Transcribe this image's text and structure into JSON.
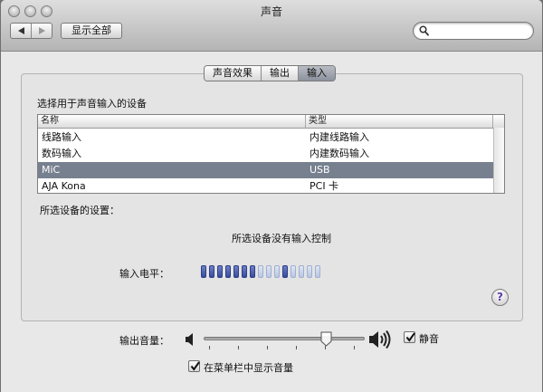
{
  "window": {
    "title": "声音"
  },
  "toolbar": {
    "show_all_label": "显示全部",
    "search_placeholder": ""
  },
  "tabs": [
    {
      "label": "声音效果",
      "active": false
    },
    {
      "label": "输出",
      "active": false
    },
    {
      "label": "输入",
      "active": true
    }
  ],
  "input_pane": {
    "title": "选择用于声音输入的设备",
    "columns": [
      "名称",
      "类型"
    ],
    "devices": [
      {
        "name": "线路输入",
        "type": "内建线路输入",
        "selected": false
      },
      {
        "name": "数码输入",
        "type": "内建数码输入",
        "selected": false
      },
      {
        "name": "MiC",
        "type": "USB",
        "selected": true
      },
      {
        "name": "AJA Kona",
        "type": "PCI 卡",
        "selected": false
      }
    ],
    "settings_label": "所选设备的设置：",
    "no_controls_text": "所选设备没有输入控制",
    "input_level_label": "输入电平：",
    "input_level": {
      "segments": 15,
      "lit": [
        0,
        1,
        2,
        3,
        4,
        5,
        6,
        10
      ]
    }
  },
  "help": {
    "glyph": "?"
  },
  "output": {
    "volume_label": "输出音量：",
    "volume_fraction": 0.77,
    "mute_label": "静音",
    "mute_checked": true,
    "show_volume_in_menubar_label": "在菜单栏中显示音量",
    "show_volume_in_menubar_checked": true
  },
  "colors": {
    "selection": "#77808f",
    "level_on": "#3a4d9c",
    "level_off": "#c6d1ea"
  },
  "icons": [
    "back-icon",
    "forward-icon",
    "search-icon",
    "speaker-low-icon",
    "speaker-high-icon",
    "help-icon",
    "checkmark-icon"
  ]
}
